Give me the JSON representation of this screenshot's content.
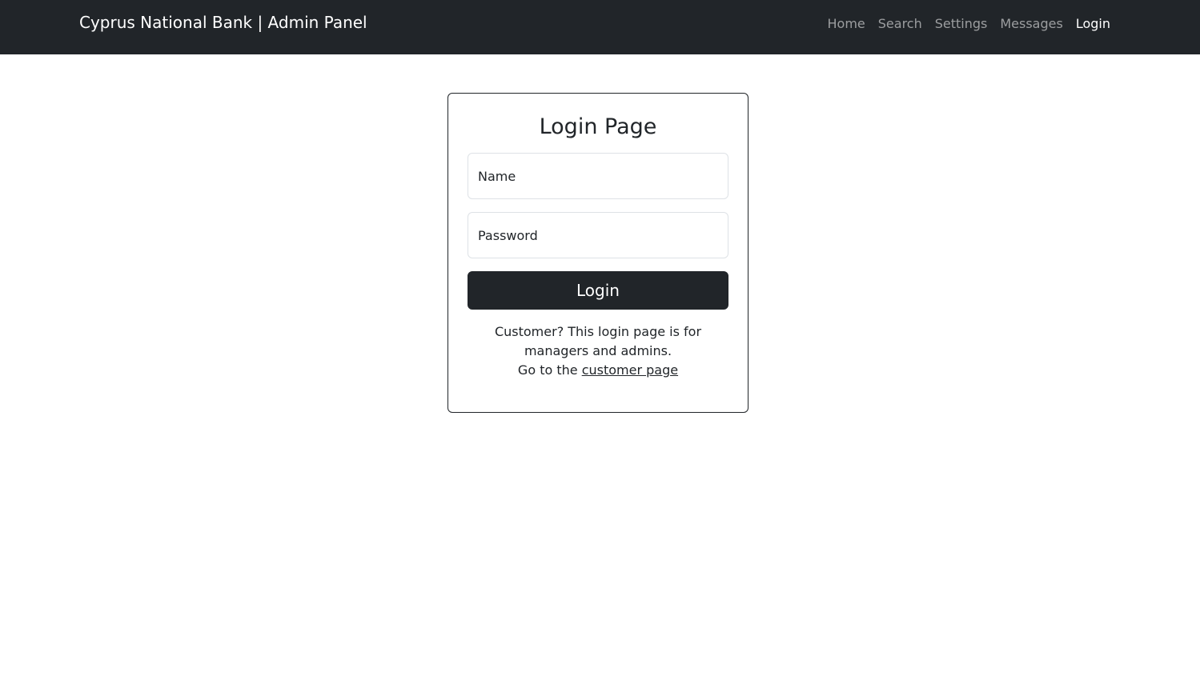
{
  "navbar": {
    "brand": "Cyprus National Bank | Admin Panel",
    "links": [
      {
        "label": "Home",
        "active": false
      },
      {
        "label": "Search",
        "active": false
      },
      {
        "label": "Settings",
        "active": false
      },
      {
        "label": "Messages",
        "active": false
      },
      {
        "label": "Login",
        "active": true
      }
    ]
  },
  "login": {
    "title": "Login Page",
    "name_placeholder": "Name",
    "password_placeholder": "Password",
    "button_label": "Login",
    "note_line1": "Customer? This login page is for managers and admins.",
    "note_line2_prefix": "Go to the ",
    "customer_link": "customer page"
  },
  "colors": {
    "navbar_bg": "#212529",
    "button_bg": "#212529",
    "border": "#dee2e6"
  }
}
